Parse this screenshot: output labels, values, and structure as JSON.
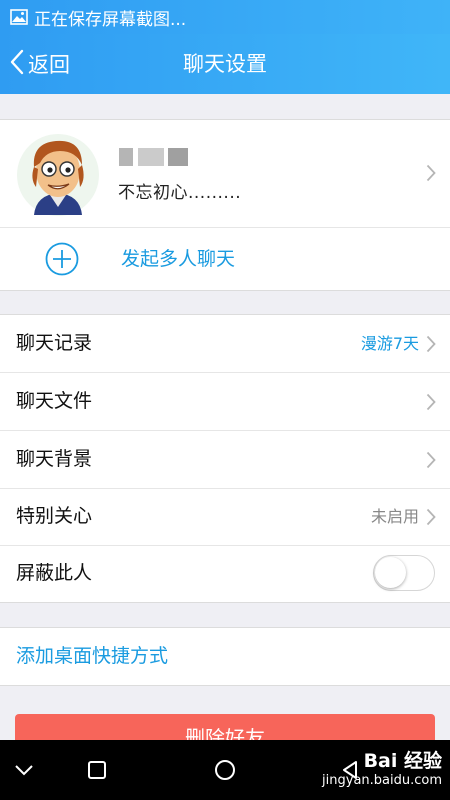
{
  "status_bar": {
    "notification_text": "正在保存屏幕截图..."
  },
  "header": {
    "back_label": "返回",
    "title": "聊天设置"
  },
  "profile": {
    "signature": "不忘初心.........",
    "group_chat_label": "发起多人聊天"
  },
  "settings": {
    "chat_history_label": "聊天记录",
    "chat_history_value": "漫游7天",
    "chat_files_label": "聊天文件",
    "chat_background_label": "聊天背景",
    "special_care_label": "特别关心",
    "special_care_value": "未启用",
    "block_label": "屏蔽此人",
    "block_enabled": false
  },
  "shortcut": {
    "label": "添加桌面快捷方式"
  },
  "delete_button": {
    "label": "删除好友"
  },
  "watermark": {
    "brand": "Bai 经验",
    "url": "jingyan.baidu.com"
  },
  "colors": {
    "header_blue": "#2f9cf2",
    "link_blue": "#1a9be0",
    "delete_red": "#f7655a",
    "muted_gray": "#888888"
  },
  "icons": {
    "status": "image-icon",
    "back": "chevron-left-icon",
    "row_arrow": "chevron-right-icon",
    "group_chat": "plus-circle-icon",
    "system_nav": [
      "chevron-down-icon",
      "square-icon",
      "circle-icon",
      "triangle-back-icon"
    ]
  }
}
